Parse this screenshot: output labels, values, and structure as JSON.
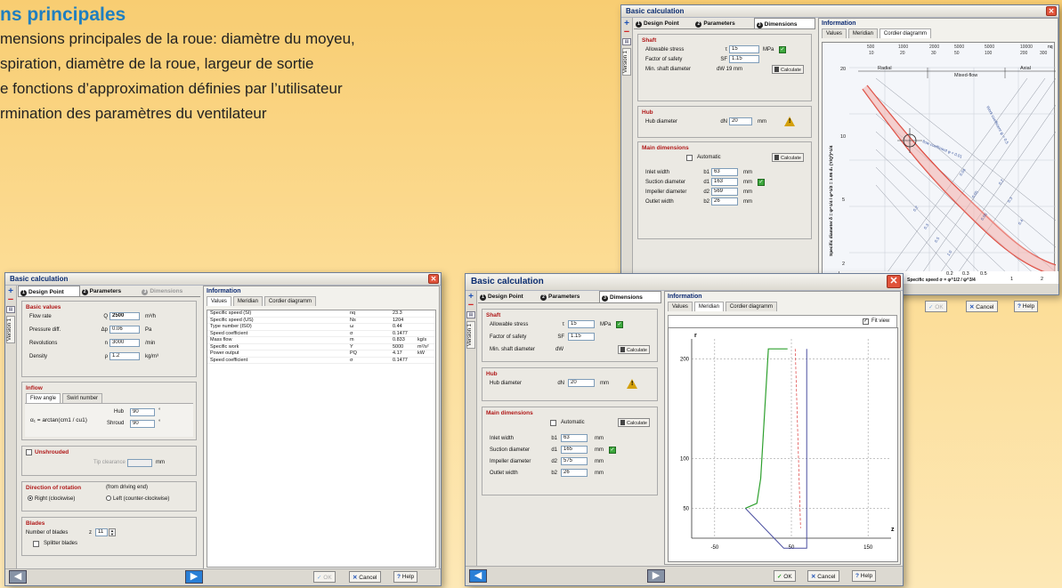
{
  "heading": {
    "title": "ns principales",
    "lines": [
      "mensions principales de la roue: diamètre du moyeu,",
      "spiration, diamètre de la roue, largeur de sortie",
      "e fonctions d’approximation définies par l’utilisateur",
      "rmination des paramètres du ventilateur"
    ]
  },
  "common": {
    "window_title": "Basic calculation",
    "close": "✕",
    "plus": "+",
    "minus": "−",
    "version_tab": "Version 1",
    "tab_design": "Design Point",
    "tab_params": "Parameters",
    "tab_dims": "Dimensions",
    "num1": "1",
    "num2": "2",
    "num3": "3",
    "info_title": "Information",
    "info_tab_values": "Values",
    "info_tab_meridian": "Meridian",
    "info_tab_cordier": "Cordier diagramm",
    "btn_ok": "OK",
    "btn_cancel": "Cancel",
    "btn_help": "Help",
    "check": "✓",
    "cross": "✕",
    "q": "?",
    "left_arrow": "◀",
    "right_arrow": "▶",
    "calculate": "Calculate"
  },
  "win_top": {
    "shaft": "Shaft",
    "allowable_stress": "Allowable stress",
    "tau_sym": "τ",
    "tau_val": "15",
    "tau_unit": "MPa",
    "factor_safety": "Factor of safety",
    "sf_sym": "SF",
    "sf_val": "1.15",
    "min_shaft": "Min. shaft diameter",
    "min_shaft_val": "dW 19 mm",
    "hub": "Hub",
    "hub_diameter": "Hub diameter",
    "dn_sym": "dN",
    "dn_val": "20",
    "mm": "mm",
    "main_dims": "Main dimensions",
    "automatic": "Automatic",
    "inlet_width": "Inlet width",
    "b1_sym": "b1",
    "b1_val": "63",
    "suction_diameter": "Suction diameter",
    "d1_sym": "d1",
    "d1_val": "163",
    "impeller_diameter": "Impeller diameter",
    "d2_sym": "d2",
    "d2_val": "569",
    "outlet_width": "Outlet width",
    "b2_sym": "b2",
    "b2_val": "26",
    "cordier": {
      "nq_top": [
        "500",
        "1000",
        "2000",
        "5000",
        "5000",
        "10000"
      ],
      "nq_bottom": [
        "10",
        "20",
        "30",
        "50",
        "100",
        "200",
        "300"
      ],
      "nq_axis": "nq",
      "y_ticks": [
        "20",
        "10",
        "5",
        "2"
      ],
      "x_ticks": [
        "0.2",
        "0.3",
        "0.5",
        "1",
        "2"
      ],
      "region_radial": "Radial",
      "region_mixed": "Mixed-flow",
      "region_axial": "Axial",
      "ylabel": "Specific diameter δ = ψ^1/4 / φ^1/2 = 1.05 d₂ (Y/Q²)^1/4",
      "xlabel": "Specific speed σ = φ^1/2 / ψ^3/4",
      "curve_label": "flow coefficient φ = 0.01",
      "work_label": "Work coefficient ψ = 0.5",
      "diag_labels": [
        "0.04",
        "0.05",
        "0.06",
        "0.2",
        "0.3",
        "0.4",
        "0.2",
        "0.3",
        "0.5",
        "1.0"
      ]
    }
  },
  "win_left": {
    "basic_values": "Basic values",
    "flow_rate": "Flow rate",
    "q_sym": "Q",
    "q_val": "2500",
    "q_unit": "m³/h",
    "pressure_diff": "Pressure diff.",
    "dp_sym": "Δp",
    "dp_val": "0.06",
    "dp_unit": "Pa",
    "revolutions": "Revolutions",
    "n_sym": "n",
    "n_val": "3000",
    "n_unit": "/min",
    "density": "Density",
    "rho_sym": "ρ",
    "rho_val": "1.2",
    "rho_unit": "kg/m³",
    "inflow": "Inflow",
    "flow_angle_tab": "Flow angle",
    "swirl_tab": "Swirl number",
    "formula": "α₁ = arctan(cm1 / cu1)",
    "hub_label": "Hub",
    "hub_val": "90",
    "shroud_label": "Shroud",
    "shroud_val": "90",
    "deg": "°",
    "unshrouded": "Unshrouded",
    "tip_clearance": "Tip clearance",
    "mm": "mm",
    "rotation": "Direction of rotation",
    "from_end": "(from driving end)",
    "right_cw": "Right (clockwise)",
    "left_ccw": "Left (counter-clockwise)",
    "blades": "Blades",
    "num_blades": "Number of blades",
    "z_sym": "z",
    "z_val": "11",
    "splitter": "Splitter blades",
    "values": [
      {
        "name": "Specific speed (SI)",
        "sym": "nq",
        "val": "23.3",
        "unit": ""
      },
      {
        "name": "Specific speed (US)",
        "sym": "Ns",
        "val": "1204",
        "unit": ""
      },
      {
        "name": "Type number (ISO)",
        "sym": "ω",
        "val": "0.44",
        "unit": ""
      },
      {
        "name": "Speed coefficient",
        "sym": "σ",
        "val": "0.1477",
        "unit": ""
      },
      {
        "name": "Mass flow",
        "sym": "m",
        "val": "0.833",
        "unit": "kg/s"
      },
      {
        "name": "Specific work",
        "sym": "Y",
        "val": "5000",
        "unit": "m²/s²"
      },
      {
        "name": "Power output",
        "sym": "PQ",
        "val": "4.17",
        "unit": "kW"
      },
      {
        "name": "Speed coefficient",
        "sym": "σ",
        "val": "0.1477",
        "unit": ""
      }
    ]
  },
  "win_right": {
    "shaft": "Shaft",
    "allowable_stress": "Allowable stress",
    "tau_sym": "τ",
    "tau_val": "15",
    "tau_unit": "MPa",
    "factor_safety": "Factor of safety",
    "sf_sym": "SF",
    "sf_val": "1.15",
    "min_shaft": "Min. shaft diameter",
    "min_shaft_val": "dW",
    "hub": "Hub",
    "hub_diameter": "Hub diameter",
    "dn_sym": "dN",
    "dn_val": "20",
    "mm": "mm",
    "main_dims": "Main dimensions",
    "automatic": "Automatic",
    "inlet_width": "Inlet width",
    "b1_sym": "b1",
    "b1_val": "63",
    "suction_diameter": "Suction diameter",
    "d1_sym": "d1",
    "d1_val": "165",
    "impeller_diameter": "Impeller diameter",
    "d2_sym": "d2",
    "d2_val": "575",
    "outlet_width": "Outlet width",
    "b2_sym": "b2",
    "b2_val": "26",
    "fit_view": "Fit view",
    "meridian": {
      "r_axis": "r",
      "z_axis": "z",
      "y_ticks": [
        "200",
        "100",
        "50"
      ],
      "x_ticks": [
        "-50",
        "50",
        "150"
      ]
    }
  },
  "chart_data": {
    "type": "line",
    "title": "",
    "xlabel": "z",
    "ylabel": "r",
    "x_ticks": [
      -50,
      50,
      150
    ],
    "y_ticks": [
      50,
      100,
      200
    ],
    "series": [
      {
        "values": [
          [
            -10,
            50
          ],
          [
            5,
            55
          ],
          [
            10,
            80
          ],
          [
            20,
            210
          ],
          [
            45,
            210
          ]
        ]
      },
      {
        "values": [
          [
            -10,
            50
          ],
          [
            40,
            10
          ],
          [
            70,
            10
          ],
          [
            70,
            210
          ]
        ]
      }
    ]
  }
}
